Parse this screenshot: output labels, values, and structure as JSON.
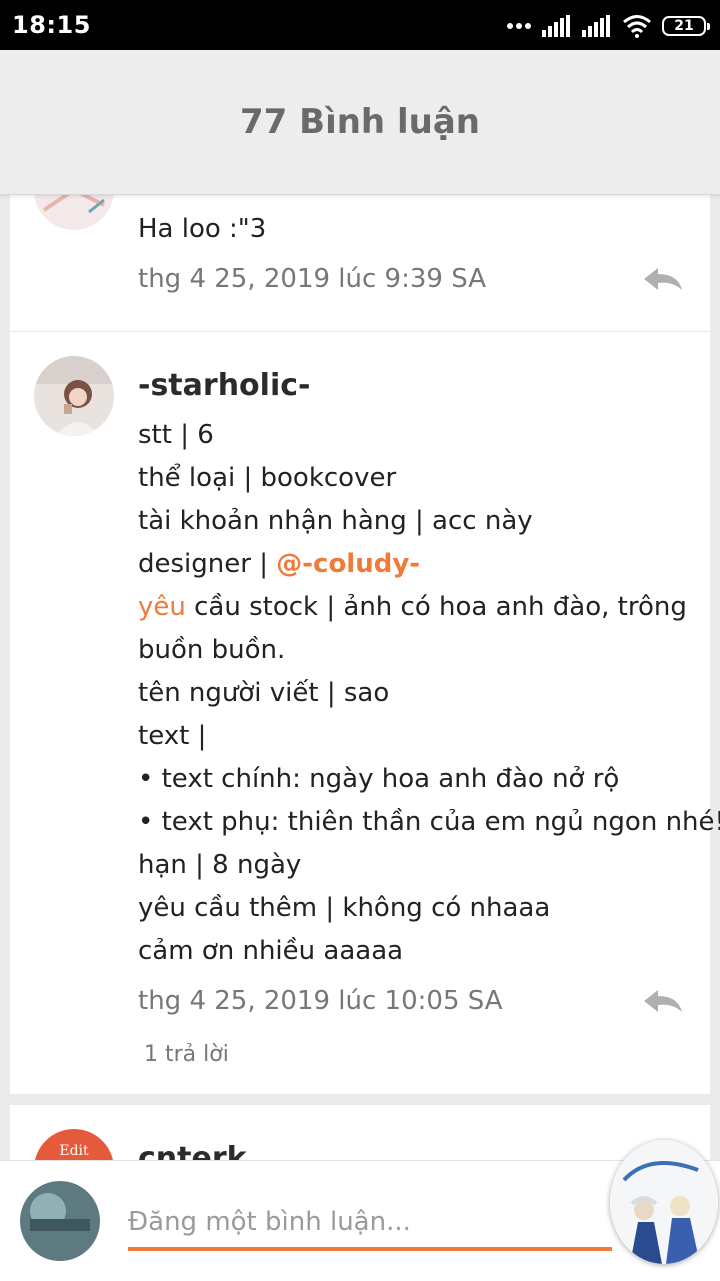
{
  "status_bar": {
    "time": "18:15",
    "battery": "21"
  },
  "header": {
    "title": "77 Bình luận"
  },
  "comments": [
    {
      "author": "",
      "lines": [
        "Ha loo :\"3"
      ],
      "date": "thg 4 25, 2019 lúc 9:39 SA"
    },
    {
      "author": "-starholic-",
      "lines": [
        "stt | 6",
        "thể loại | bookcover",
        "tài khoản nhận hàng | acc này",
        "designer | ",
        "@-coludy-",
        "yêu",
        " cầu stock | ảnh có hoa anh đào, trông",
        "buồn buồn.",
        "tên người viết | sao",
        "text |",
        "• text chính: ngày hoa anh đào nở rộ",
        "• text phụ: thiên thần của em ngủ ngon nhé!",
        "hạn | 8 ngày",
        "yêu cầu thêm | không có nhaaa",
        "cảm ơn nhiều aaaaa"
      ],
      "date": "thg 4 25, 2019 lúc 10:05 SA",
      "replies": "1 trả lời"
    },
    {
      "author": "cnterk"
    }
  ],
  "composer": {
    "placeholder": "Đăng một bình luận..."
  },
  "colors": {
    "accent": "#f07a3a",
    "header_bg": "#ededed",
    "page_bg": "#ebebeb"
  }
}
